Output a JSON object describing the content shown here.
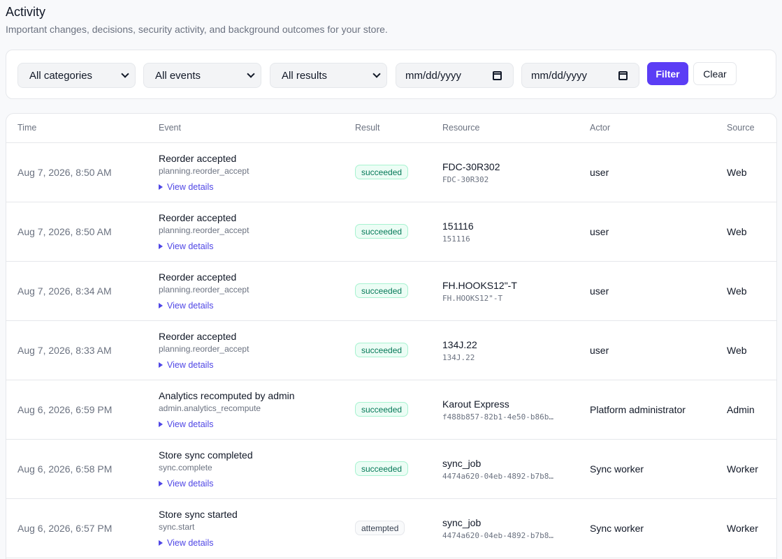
{
  "header": {
    "title": "Activity",
    "subtitle": "Important changes, decisions, security activity, and background outcomes for your store."
  },
  "filters": {
    "category": "All categories",
    "event": "All events",
    "result": "All results",
    "date_from_placeholder": "mm/dd/yyyy",
    "date_to_placeholder": "mm/dd/yyyy",
    "filter_label": "Filter",
    "clear_label": "Clear"
  },
  "table": {
    "columns": {
      "time": "Time",
      "event": "Event",
      "result": "Result",
      "resource": "Resource",
      "actor": "Actor",
      "source": "Source"
    },
    "details_label": "View details",
    "rows": [
      {
        "time": "Aug 7, 2026, 8:50 AM",
        "event_title": "Reorder accepted",
        "event_code": "planning.reorder_accept",
        "result": "succeeded",
        "resource_name": "FDC-30R302",
        "resource_id": "FDC-30R302",
        "actor": "user",
        "source": "Web"
      },
      {
        "time": "Aug 7, 2026, 8:50 AM",
        "event_title": "Reorder accepted",
        "event_code": "planning.reorder_accept",
        "result": "succeeded",
        "resource_name": "151116",
        "resource_id": "151116",
        "actor": "user",
        "source": "Web"
      },
      {
        "time": "Aug 7, 2026, 8:34 AM",
        "event_title": "Reorder accepted",
        "event_code": "planning.reorder_accept",
        "result": "succeeded",
        "resource_name": "FH.HOOKS12\"-T",
        "resource_id": "FH.HOOKS12\"-T",
        "actor": "user",
        "source": "Web"
      },
      {
        "time": "Aug 7, 2026, 8:33 AM",
        "event_title": "Reorder accepted",
        "event_code": "planning.reorder_accept",
        "result": "succeeded",
        "resource_name": "134J.22",
        "resource_id": "134J.22",
        "actor": "user",
        "source": "Web"
      },
      {
        "time": "Aug 6, 2026, 6:59 PM",
        "event_title": "Analytics recomputed by admin",
        "event_code": "admin.analytics_recompute",
        "result": "succeeded",
        "resource_name": "Karout Express",
        "resource_id": "f488b857-82b1-4e50-b86b…",
        "actor": "Platform administrator",
        "source": "Admin"
      },
      {
        "time": "Aug 6, 2026, 6:58 PM",
        "event_title": "Store sync completed",
        "event_code": "sync.complete",
        "result": "succeeded",
        "resource_name": "sync_job",
        "resource_id": "4474a620-04eb-4892-b7b8…",
        "actor": "Sync worker",
        "source": "Worker"
      },
      {
        "time": "Aug 6, 2026, 6:57 PM",
        "event_title": "Store sync started",
        "event_code": "sync.start",
        "result": "attempted",
        "resource_name": "sync_job",
        "resource_id": "4474a620-04eb-4892-b7b8…",
        "actor": "Sync worker",
        "source": "Worker"
      }
    ]
  }
}
